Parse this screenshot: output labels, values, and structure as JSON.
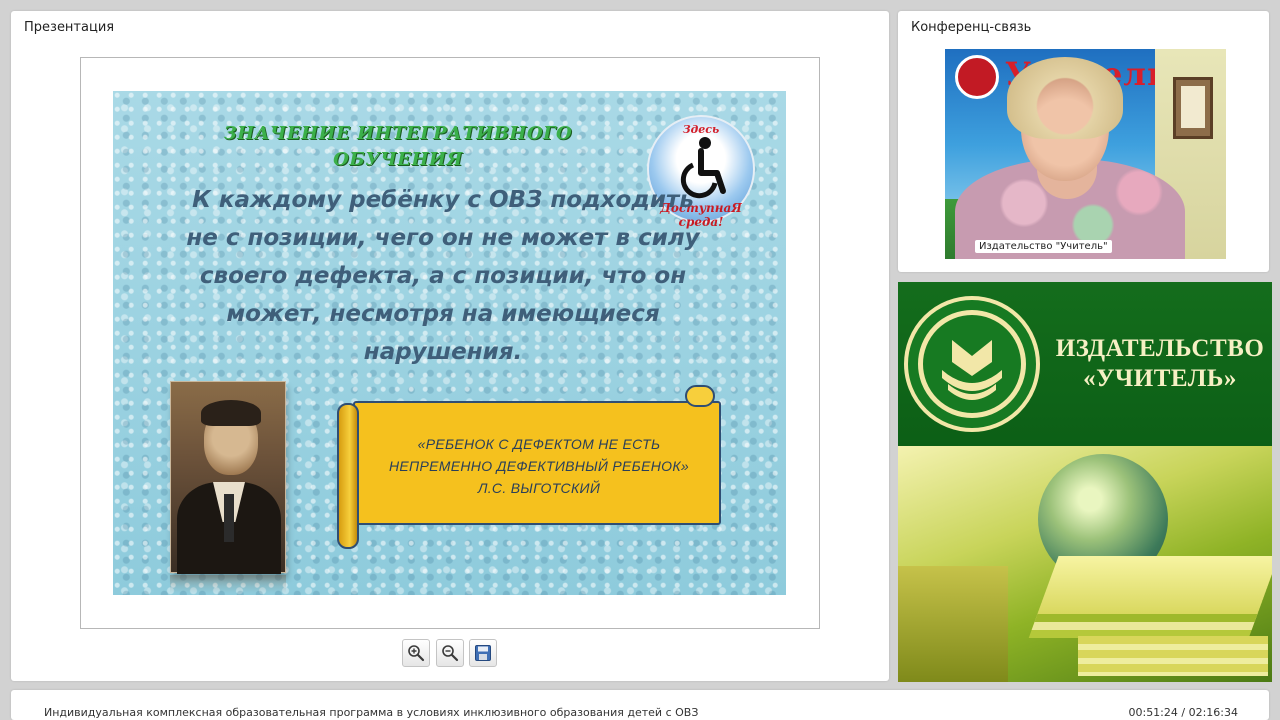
{
  "presentation": {
    "title": "Презентация",
    "slide": {
      "heading": "ЗНАЧЕНИЕ ИНТЕГРАТИВНОГО ОБУЧЕНИЯ",
      "quote": "К каждому ребёнку с ОВЗ подходить не с позиции, чего он не может в силу своего дефекта, а с позиции, что он может, несмотря на имеющиеся нарушения.",
      "badge_top": "Здесь",
      "badge_bottom": "ДоступнаЯ среда!",
      "scroll_line1": "«РЕБЕНОК С ДЕФЕКТОМ НЕ ЕСТЬ",
      "scroll_line2": "НЕПРЕМЕННО ДЕФЕКТИВНЫЙ РЕБЕНОК»",
      "scroll_line3": "Л.С. ВЫГОТСКИЙ"
    },
    "toolbar": {
      "zoom_in_icon": "zoom-in-icon",
      "zoom_out_icon": "zoom-out-icon",
      "save_icon": "save-icon"
    }
  },
  "conference": {
    "title": "Конференц-связь",
    "video_banner": "Учитель",
    "speaker_label": "Издательство \"Учитель\""
  },
  "publisher": {
    "name_line1": "ИЗДАТЕЛЬСТВО",
    "name_line2": "«УЧИТЕЛЬ»"
  },
  "footer": {
    "course_title": "Индивидуальная комплексная образовательная программа в условиях инклюзивного образования детей с ОВЗ",
    "time": "00:51:24 / 02:16:34"
  },
  "colors": {
    "slide_heading": "#3bb04a",
    "slide_quote": "#3f5f7a",
    "scroll": "#f5c11e",
    "publisher_green": "#146d1c"
  }
}
